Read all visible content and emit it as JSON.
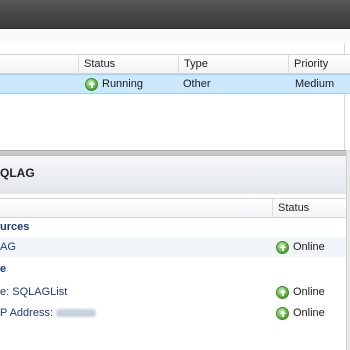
{
  "upper_list": {
    "columns": [
      {
        "label": ""
      },
      {
        "label": "Status"
      },
      {
        "label": "Type"
      },
      {
        "label": "Priority"
      }
    ],
    "rows": [
      {
        "name": "",
        "status": "Running",
        "type": "Other",
        "priority": "Medium",
        "status_icon": "green-up-arrow-icon"
      }
    ]
  },
  "detail": {
    "title": "QLAG",
    "columns": [
      {
        "label": ""
      },
      {
        "label": "Status"
      }
    ],
    "groups": [
      {
        "label": "urces",
        "items": [
          {
            "name": "AG",
            "status": "Online",
            "status_icon": "green-up-arrow-icon"
          }
        ]
      },
      {
        "label": "e",
        "items": [
          {
            "name": "e: SQLAGList",
            "status": "Online",
            "status_icon": "green-up-arrow-icon"
          },
          {
            "name": "P Address:",
            "status": "Online",
            "status_icon": "green-up-arrow-icon"
          }
        ]
      }
    ]
  },
  "colors": {
    "selection": "#cce8ff",
    "group_text": "#1e3a78",
    "topbar": "#3b3b3b"
  }
}
